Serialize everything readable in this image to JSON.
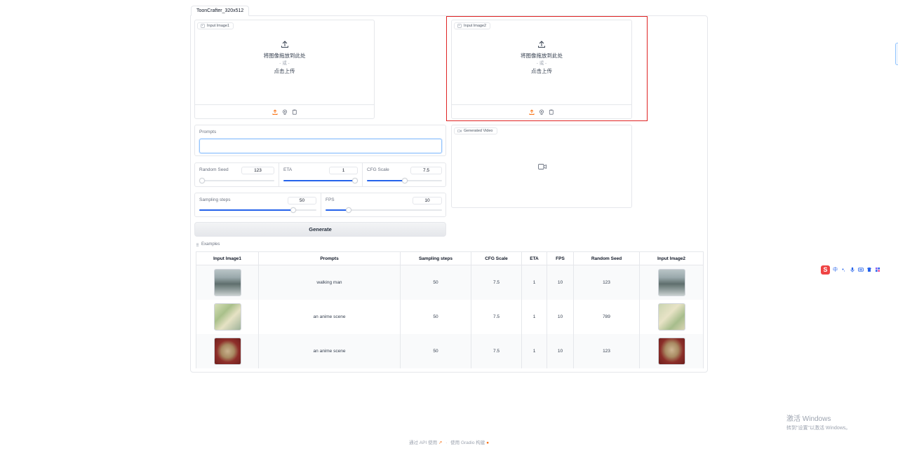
{
  "tab": {
    "label": "ToonCrafter_320x512"
  },
  "image1": {
    "label": "Input Image1",
    "drop_text": "将图像拖放到此处",
    "or_text": "- 或 -",
    "click_text": "点击上传"
  },
  "image2": {
    "label": "Input Image2",
    "drop_text": "将图像拖放到此处",
    "or_text": "- 或 -",
    "click_text": "点击上传"
  },
  "prompts": {
    "label": "Prompts",
    "value": ""
  },
  "sliders": {
    "random_seed": {
      "label": "Random Seed",
      "value": "123",
      "fraction": 0.0
    },
    "eta": {
      "label": "ETA",
      "value": "1",
      "fraction": 1.0
    },
    "cfg_scale": {
      "label": "CFG Scale",
      "value": "7.5",
      "fraction": 0.5
    },
    "sampling_steps": {
      "label": "Sampling steps",
      "value": "50",
      "fraction": 0.8
    },
    "fps": {
      "label": "FPS",
      "value": "10",
      "fraction": 0.2
    }
  },
  "video": {
    "label": "Generated Video"
  },
  "generate_label": "Generate",
  "examples": {
    "label": "Examples",
    "headers": [
      "Input Image1",
      "Prompts",
      "Sampling steps",
      "CFG Scale",
      "ETA",
      "FPS",
      "Random Seed",
      "Input Image2"
    ],
    "rows": [
      {
        "prompt": "walking man",
        "steps": "50",
        "cfg": "7.5",
        "eta": "1",
        "fps": "10",
        "seed": "123"
      },
      {
        "prompt": "an anime scene",
        "steps": "50",
        "cfg": "7.5",
        "eta": "1",
        "fps": "10",
        "seed": "789"
      },
      {
        "prompt": "an anime scene",
        "steps": "50",
        "cfg": "7.5",
        "eta": "1",
        "fps": "10",
        "seed": "123"
      }
    ]
  },
  "footer": {
    "api_text": "通过 API 使用",
    "separator": "·",
    "built_text": "使用 Gradio 构建"
  },
  "watermark": {
    "line1": "激活 Windows",
    "line2": "转到\"设置\"以激活 Windows。"
  },
  "ime": {
    "mode": "中",
    "punct": "•,"
  },
  "colors": {
    "accent": "#2563eb",
    "highlight": "#e02424",
    "upload_icon": "#f97316"
  }
}
